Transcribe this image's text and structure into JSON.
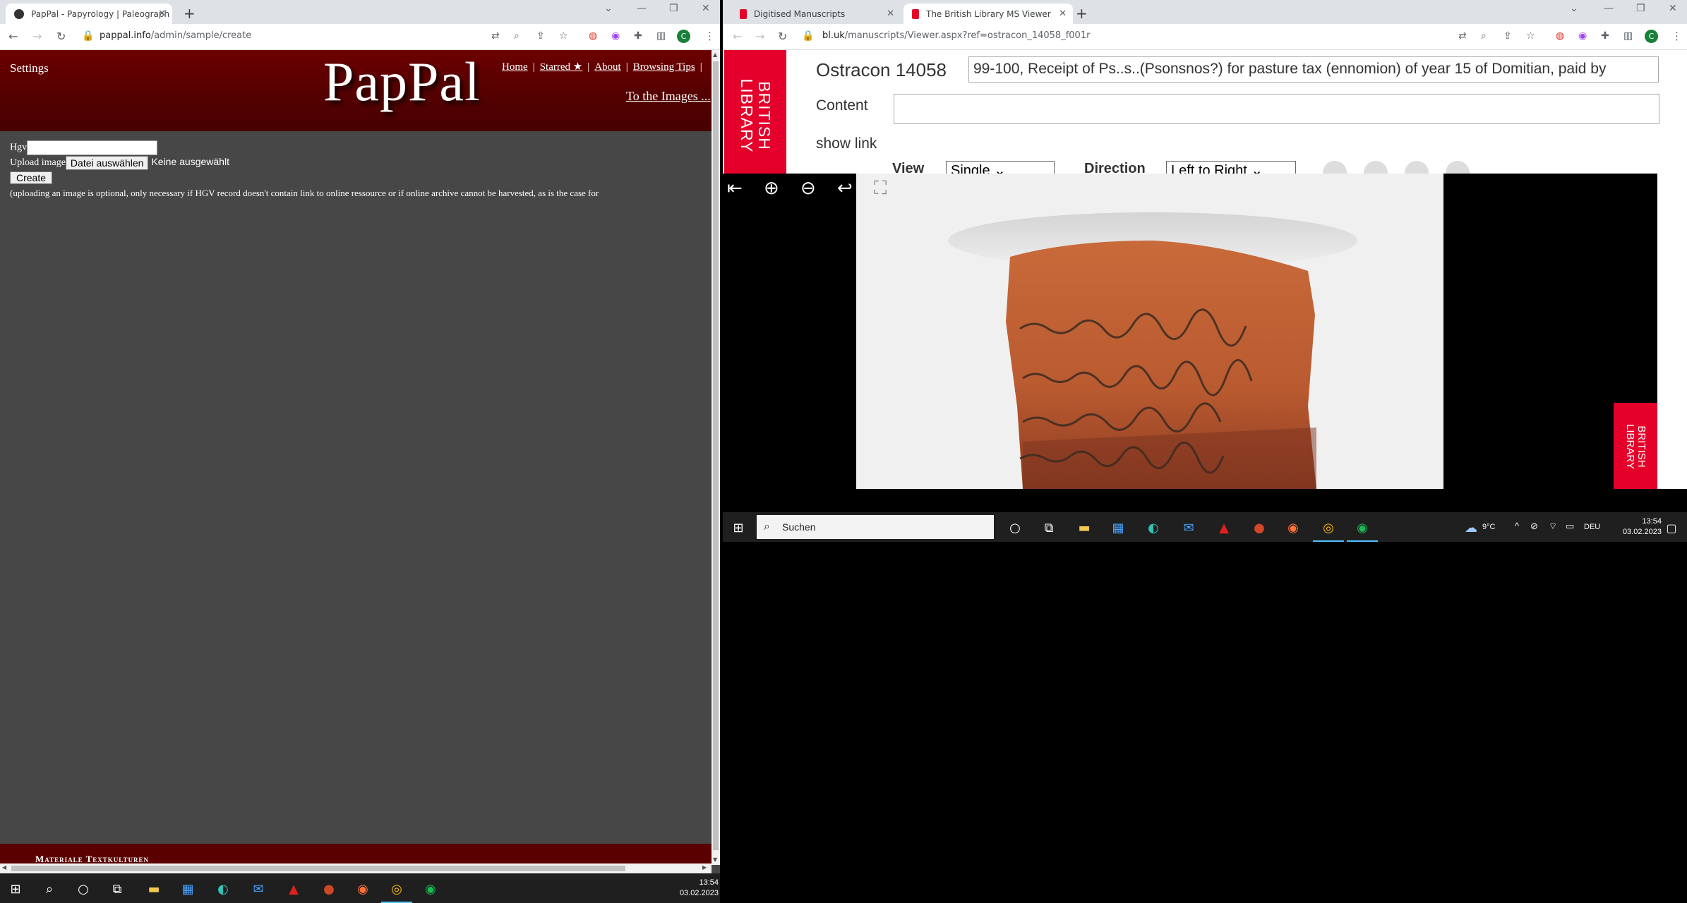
{
  "left_window": {
    "tab_title": "PapPal - Papyrology | Paleograph",
    "url_host": "pappal.info",
    "url_path": "/admin/sample/create",
    "profile_initial": "C"
  },
  "pappal": {
    "settings": "Settings",
    "logo": "PapPal",
    "nav": [
      "Home",
      "Starred ★",
      "About",
      "Browsing Tips"
    ],
    "to_images": "To the Images ...",
    "hgv_label": "Hgv",
    "upload_label": "Upload image",
    "file_button": "Datei auswählen",
    "no_file": "Keine ausgewählt",
    "create_button": "Create",
    "note": "(uploading an image is optional, only necessary if HGV record doesn't contain link to online ressource or if online archive cannot be harvested, as is the case for",
    "footer": "Materiale Textkulturen"
  },
  "right_window": {
    "tabs": [
      "Digitised Manuscripts",
      "The British Library MS Viewer"
    ],
    "url_host": "bl.uk",
    "url_path": "/manuscripts/Viewer.aspx?ref=ostracon_14058_f001r",
    "profile_initial": "C"
  },
  "bl": {
    "logo_text": "BRITISH LIBRARY",
    "title": "Ostracon 14058",
    "description": "99-100, Receipt of Ps..s..(Psonsnos?) for pasture tax (ennomion) of year 15 of Domitian, paid by",
    "content_label": "Content",
    "show_link": "show link",
    "view_label": "View",
    "view_value": "Single",
    "direction_label": "Direction",
    "direction_value": "Left to Right",
    "watermark": "BRITISH LIBRARY"
  },
  "taskbar_left": {
    "time": "13:54",
    "date": "03.02.2023"
  },
  "taskbar_right": {
    "search_placeholder": "Suchen",
    "weather": "9°C",
    "lang": "DEU",
    "time": "13:54",
    "date": "03.02.2023"
  },
  "colors": {
    "pappal_red": "#6d0000",
    "bl_red": "#e4002b",
    "taskbar": "#1f1f1f"
  }
}
